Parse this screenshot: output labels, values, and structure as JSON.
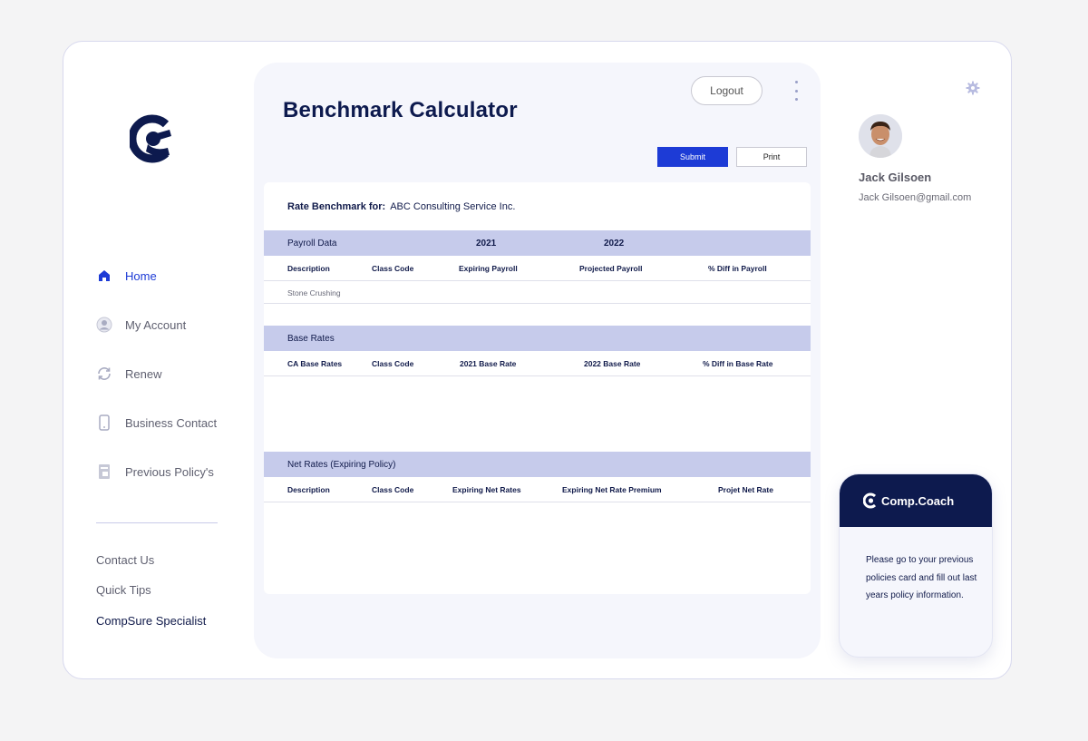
{
  "sidebar": {
    "nav": [
      {
        "label": "Home",
        "icon": "home-icon",
        "active": true
      },
      {
        "label": "My Account",
        "icon": "user-icon",
        "active": false
      },
      {
        "label": "Renew",
        "icon": "refresh-icon",
        "active": false
      },
      {
        "label": "Business Contact",
        "icon": "phone-icon",
        "active": false
      },
      {
        "label": "Previous Policy's",
        "icon": "document-icon",
        "active": false
      }
    ],
    "footer_links": [
      "Contact Us",
      "Quick Tips",
      "CompSure Specialist"
    ]
  },
  "header": {
    "title": "Benchmark Calculator",
    "logout_label": "Logout",
    "submit_label": "Submit",
    "print_label": "Print"
  },
  "benchmark": {
    "rate_for_label": "Rate Benchmark for:",
    "company": "ABC Consulting Service Inc.",
    "payroll": {
      "title": "Payroll Data",
      "years": [
        "2021",
        "2022"
      ],
      "columns": [
        "Description",
        "Class Code",
        "Expiring Payroll",
        "Projected Payroll",
        "% Diff in Payroll"
      ],
      "rows": [
        {
          "description": "Stone Crushing"
        }
      ]
    },
    "base_rates": {
      "title": "Base Rates",
      "columns": [
        "CA Base Rates",
        "Class Code",
        "2021 Base Rate",
        "2022 Base Rate",
        "% Diff in Base Rate"
      ]
    },
    "net_rates": {
      "title": "Net Rates (Expiring Policy)",
      "columns": [
        "Description",
        "Class Code",
        "Expiring Net Rates",
        "Expiring Net Rate Premium",
        "Projet Net Rate"
      ]
    }
  },
  "user": {
    "name": "Jack Gilsoen",
    "email": "Jack Gilsoen@gmail.com"
  },
  "coach": {
    "title": "Comp.Coach",
    "message": "Please go to your previous policies card and fill out last years policy information."
  },
  "colors": {
    "accent": "#1d3bd6",
    "navy": "#0d1a4e",
    "section_header": "#c6cbeb",
    "panel_bg": "#f5f6fc"
  }
}
